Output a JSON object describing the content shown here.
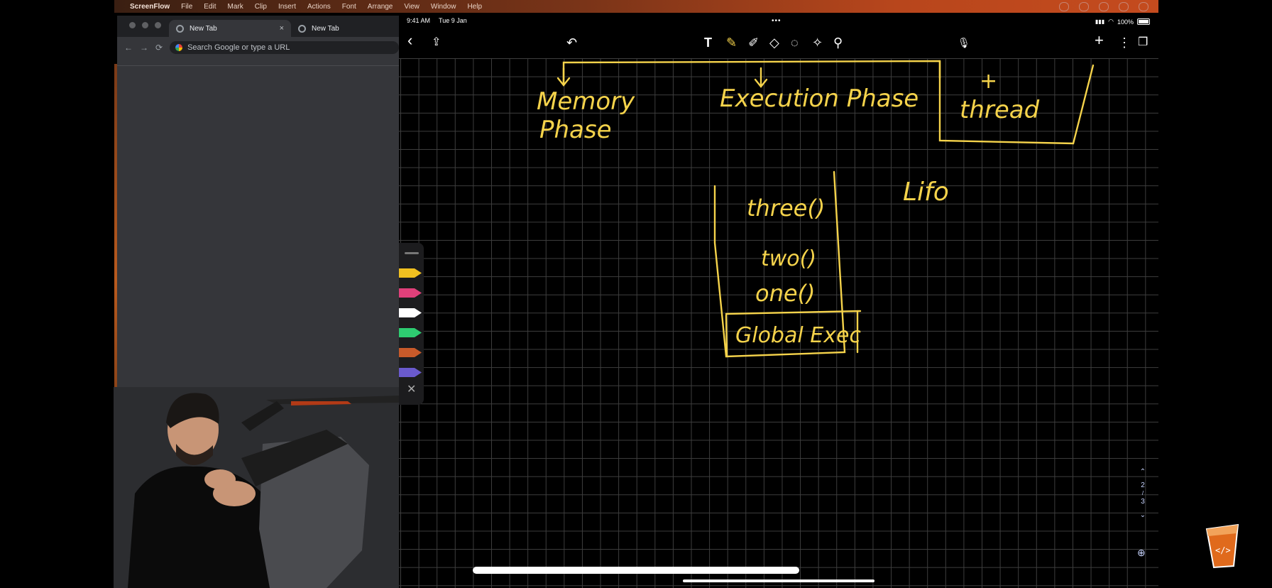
{
  "mac_menubar": {
    "app_name": "ScreenFlow",
    "items": [
      "File",
      "Edit",
      "Mark",
      "Clip",
      "Insert",
      "Actions",
      "Font",
      "Arrange",
      "View",
      "Window",
      "Help"
    ]
  },
  "browser": {
    "tabs": [
      {
        "label": "New Tab",
        "active": true
      },
      {
        "label": "New Tab",
        "active": false
      }
    ],
    "close_glyph": "×",
    "omnibox_placeholder": "Search Google or type a URL",
    "nav": {
      "back": "←",
      "forward": "→",
      "reload": "⟳"
    }
  },
  "ipad": {
    "status": {
      "time": "9:41 AM",
      "date": "Tue 9 Jan",
      "battery": "100%",
      "multitask": "•••"
    },
    "toolbar": {
      "left": [
        {
          "icon": "back-chevron-icon",
          "glyph": "‹"
        },
        {
          "icon": "share-icon",
          "glyph": "⇪"
        }
      ],
      "undo": {
        "icon": "undo-icon",
        "glyph": "↶"
      },
      "tools": [
        {
          "icon": "text-tool-icon",
          "glyph": "T"
        },
        {
          "icon": "pen-tool-icon",
          "glyph": "✎"
        },
        {
          "icon": "highlighter-tool-icon",
          "glyph": "✐"
        },
        {
          "icon": "eraser-tool-icon",
          "glyph": "◇"
        },
        {
          "icon": "lasso-tool-icon",
          "glyph": "◌"
        },
        {
          "icon": "shapes-tool-icon",
          "glyph": "✧"
        },
        {
          "icon": "laser-tool-icon",
          "glyph": "⚲"
        }
      ],
      "mic": {
        "icon": "microphone-icon",
        "glyph": "🎙"
      },
      "right": [
        {
          "icon": "add-icon",
          "glyph": "+"
        },
        {
          "icon": "more-icon",
          "glyph": "⋮"
        },
        {
          "icon": "pages-icon",
          "glyph": "❐"
        }
      ]
    },
    "palette": {
      "pens": [
        {
          "color": "#f0c020"
        },
        {
          "color": "#e0407a"
        },
        {
          "color": "#ffffff"
        },
        {
          "color": "#2ecc71"
        },
        {
          "color": "#c85a2a"
        },
        {
          "color": "#6a5acd"
        }
      ],
      "close_glyph": "✕"
    },
    "pager": {
      "up": "⌃",
      "current": "2",
      "separator": "/",
      "total": "3",
      "down": "⌄"
    },
    "zoom_glyph": "⊕"
  },
  "notes": {
    "memory_phase": [
      "Memory",
      "Phase"
    ],
    "execution_phase": "Execution Phase",
    "plus": "+",
    "thread": "thread",
    "lifo": "Lifo",
    "stack_items": [
      "three()",
      "two()",
      "one()"
    ],
    "global_exec": "Global Exec",
    "ink_color": "#f5d34b"
  }
}
